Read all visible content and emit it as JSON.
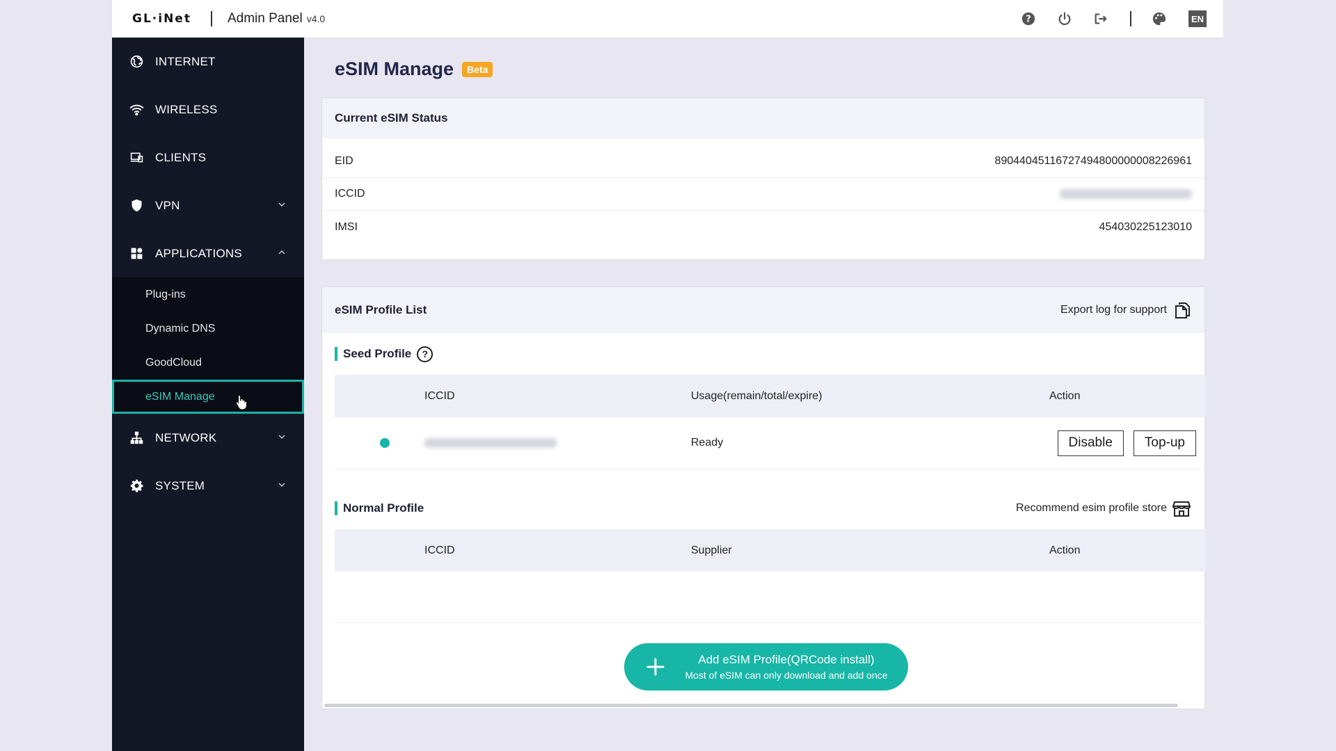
{
  "topbar": {
    "logo": "GL·iNet",
    "title": "Admin Panel",
    "version": "v4.0",
    "lang": "EN",
    "icons": [
      "help-icon",
      "power-icon",
      "logout-icon",
      "palette-icon"
    ]
  },
  "sidebar": {
    "items": [
      {
        "label": "INTERNET",
        "icon": "globe-icon"
      },
      {
        "label": "WIRELESS",
        "icon": "wifi-icon"
      },
      {
        "label": "CLIENTS",
        "icon": "devices-icon"
      },
      {
        "label": "VPN",
        "icon": "shield-icon"
      },
      {
        "label": "APPLICATIONS",
        "icon": "apps-icon"
      },
      {
        "label": "NETWORK",
        "icon": "network-icon"
      },
      {
        "label": "SYSTEM",
        "icon": "gear-icon"
      }
    ],
    "sub_items": [
      "Plug-ins",
      "Dynamic DNS",
      "GoodCloud",
      "eSIM Manage"
    ],
    "active_sub": "eSIM Manage"
  },
  "page": {
    "title": "eSIM Manage",
    "badge": "Beta"
  },
  "status": {
    "heading": "Current eSIM Status",
    "rows": [
      {
        "label": "EID",
        "value": "89044045116727494800000008226961"
      },
      {
        "label": "ICCID",
        "value": ""
      },
      {
        "label": "IMSI",
        "value": "454030225123010"
      }
    ]
  },
  "profiles": {
    "heading": "eSIM Profile List",
    "export_label": "Export log for support",
    "seed": {
      "label": "Seed Profile",
      "help": "?",
      "columns": [
        "ICCID",
        "Usage(remain/total/expire)",
        "Action"
      ],
      "rows": [
        {
          "status_color": "#17b6a6",
          "iccid": "",
          "usage": "Ready",
          "actions": [
            "Disable",
            "Top-up"
          ]
        }
      ]
    },
    "normal": {
      "label": "Normal Profile",
      "recommend_label": "Recommend esim profile store",
      "columns": [
        "ICCID",
        "Supplier",
        "Action"
      ]
    },
    "add_button": {
      "main": "Add eSIM Profile(QRCode install)",
      "sub": "Most of eSIM can only download and add once"
    }
  },
  "colors": {
    "accent": "#17b6a6",
    "sidebar_bg": "#131726",
    "badge": "#f5a623"
  }
}
